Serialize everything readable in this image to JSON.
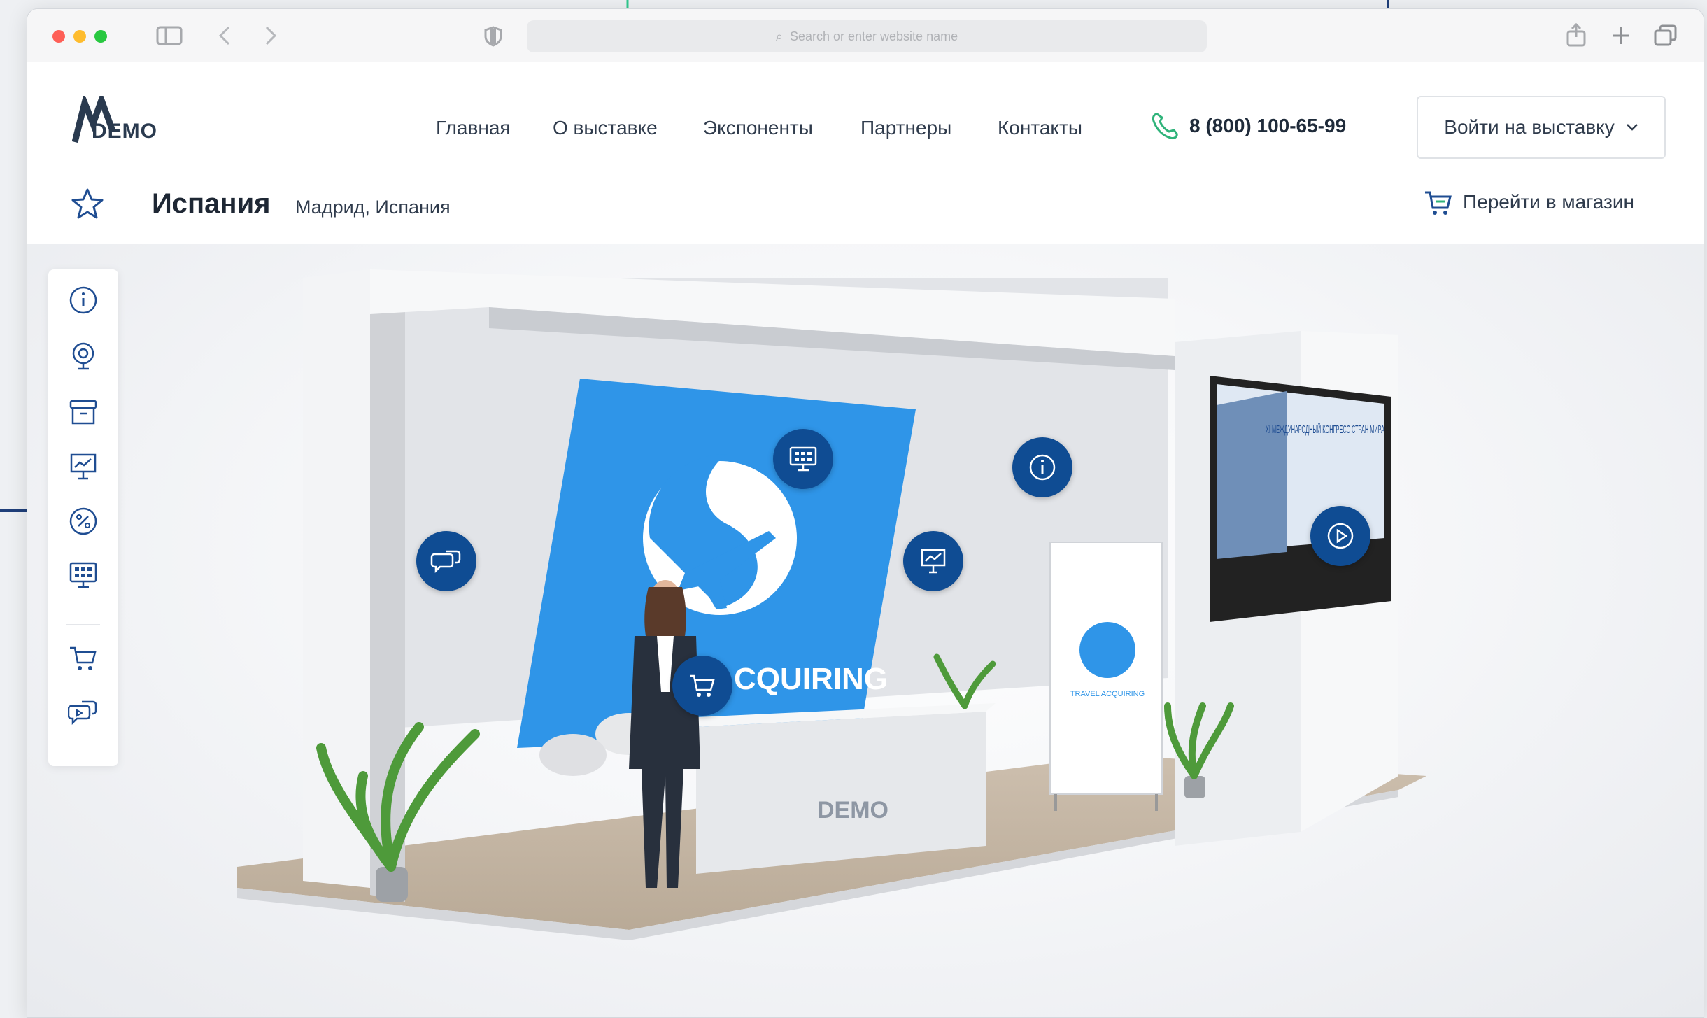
{
  "browser": {
    "url_placeholder": "Search or enter website name"
  },
  "header": {
    "logo_text": "DEMO",
    "nav": [
      "Главная",
      "О выставке",
      "Экспоненты",
      "Партнеры",
      "Контакты"
    ],
    "phone": "8 (800) 100-65-99",
    "login_label": "Войти на выставку"
  },
  "subheader": {
    "title": "Испания",
    "location": "Мадрид, Испания",
    "shop_label": "Перейти в магазин"
  },
  "booth": {
    "banner_text": "CQUIRING",
    "rollup_text": "TRAVEL ACQUIRING",
    "desk_logo": "DEMO",
    "screen_title": "XI МЕЖДУНАРОДНЫЙ КОНГРЕСС СТРАН МИРА"
  },
  "colors": {
    "brand_blue": "#0f4c93",
    "banner_blue": "#2f95e8",
    "phone_green": "#2fb37a"
  }
}
